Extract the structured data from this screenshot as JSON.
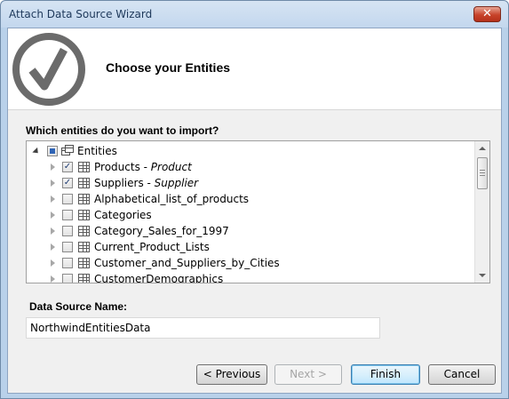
{
  "window": {
    "title": "Attach Data Source Wizard",
    "close_glyph": "✕"
  },
  "header": {
    "title": "Choose your Entities",
    "logo_icon": "checkmark-circle-icon"
  },
  "entities_section": {
    "question": "Which entities do you want to import?",
    "root": {
      "label": "Entities",
      "expanded": true,
      "checked": "partial"
    },
    "items": [
      {
        "name": "Products",
        "suffix": "Product",
        "checked": true
      },
      {
        "name": "Suppliers",
        "suffix": "Supplier",
        "checked": true
      },
      {
        "name": "Alphabetical_list_of_products",
        "suffix": "",
        "checked": false
      },
      {
        "name": "Categories",
        "suffix": "",
        "checked": false
      },
      {
        "name": "Category_Sales_for_1997",
        "suffix": "",
        "checked": false
      },
      {
        "name": "Current_Product_Lists",
        "suffix": "",
        "checked": false
      },
      {
        "name": "Customer_and_Suppliers_by_Cities",
        "suffix": "",
        "checked": false
      },
      {
        "name": "CustomerDemographics",
        "suffix": "",
        "checked": false
      }
    ],
    "separator": " - ",
    "check_glyph": "✓"
  },
  "data_source": {
    "label": "Data Source Name:",
    "value": "NorthwindEntitiesData"
  },
  "buttons": {
    "previous": "< Previous",
    "next": "Next >",
    "finish": "Finish",
    "cancel": "Cancel"
  },
  "colors": {
    "title_text": "#1e395b",
    "close_red": "#c7432a",
    "check_blue": "#1c3a70",
    "default_button_border": "#3c7fb1"
  }
}
